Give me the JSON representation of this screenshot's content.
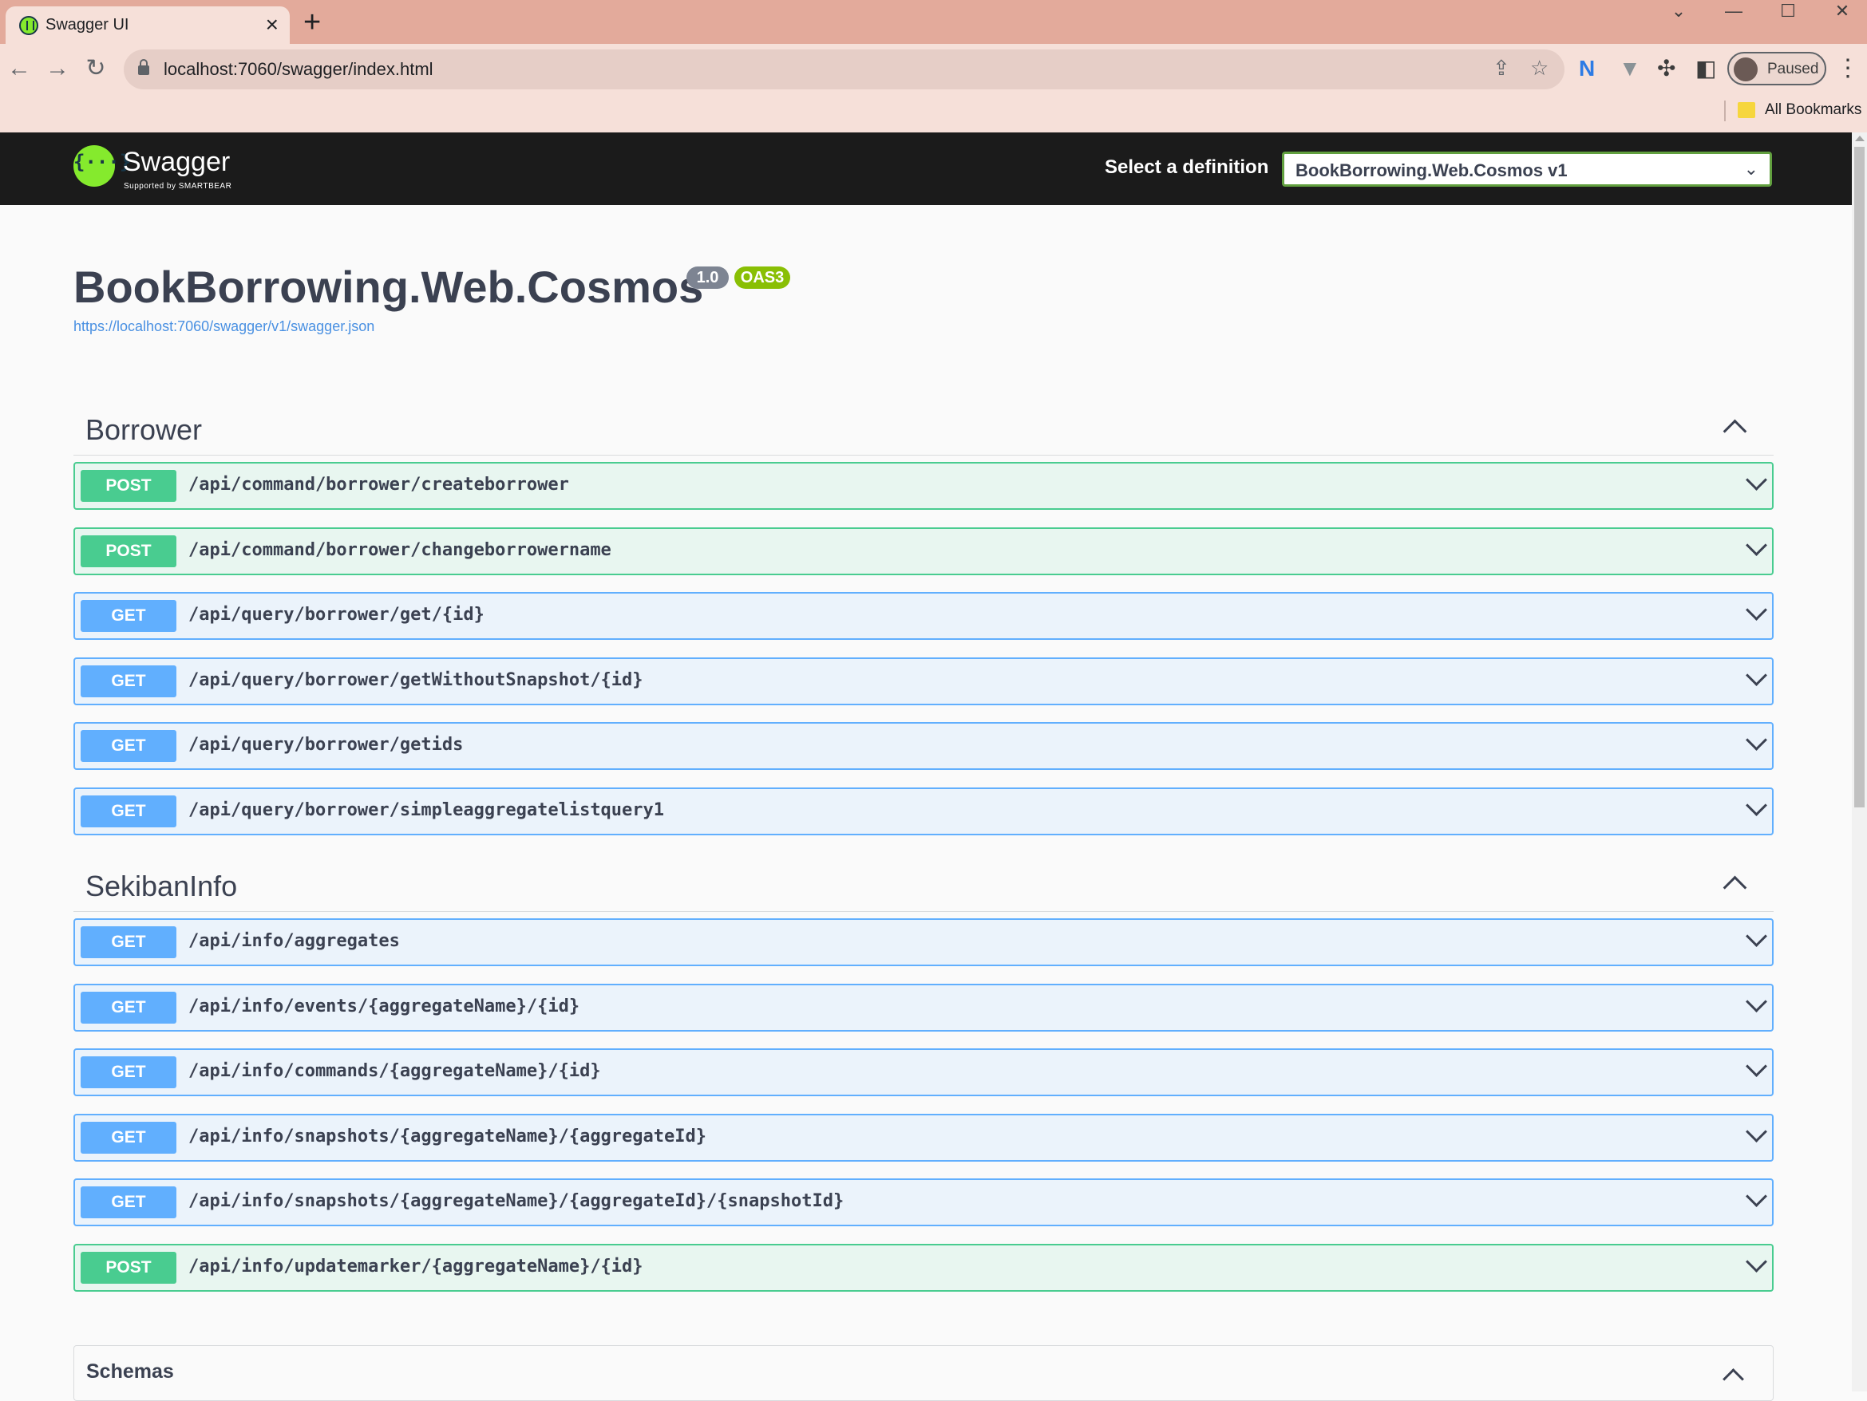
{
  "browser": {
    "tab_title": "Swagger UI",
    "url": "localhost:7060/swagger/index.html",
    "profile_status": "Paused",
    "bookmarks_label": "All Bookmarks"
  },
  "topbar": {
    "logo_text": "Swagger",
    "logo_sub": "Supported by SMARTBEAR",
    "select_label": "Select a definition",
    "definition_value": "BookBorrowing.Web.Cosmos v1"
  },
  "info": {
    "title": "BookBorrowing.Web.Cosmos",
    "version": "1.0",
    "oas": "OAS3",
    "spec_url": "https://localhost:7060/swagger/v1/swagger.json"
  },
  "tags": [
    {
      "name": "Borrower",
      "operations": [
        {
          "method": "POST",
          "path": "/api/command/borrower/createborrower"
        },
        {
          "method": "POST",
          "path": "/api/command/borrower/changeborrowername"
        },
        {
          "method": "GET",
          "path": "/api/query/borrower/get/{id}"
        },
        {
          "method": "GET",
          "path": "/api/query/borrower/getWithoutSnapshot/{id}"
        },
        {
          "method": "GET",
          "path": "/api/query/borrower/getids"
        },
        {
          "method": "GET",
          "path": "/api/query/borrower/simpleaggregatelistquery1"
        }
      ]
    },
    {
      "name": "SekibanInfo",
      "operations": [
        {
          "method": "GET",
          "path": "/api/info/aggregates"
        },
        {
          "method": "GET",
          "path": "/api/info/events/{aggregateName}/{id}"
        },
        {
          "method": "GET",
          "path": "/api/info/commands/{aggregateName}/{id}"
        },
        {
          "method": "GET",
          "path": "/api/info/snapshots/{aggregateName}/{aggregateId}"
        },
        {
          "method": "GET",
          "path": "/api/info/snapshots/{aggregateName}/{aggregateId}/{snapshotId}"
        },
        {
          "method": "POST",
          "path": "/api/info/updatemarker/{aggregateName}/{id}"
        }
      ]
    }
  ],
  "schemas": {
    "title": "Schemas"
  },
  "colors": {
    "post": "#49cc90",
    "get": "#61affe",
    "swagger_green": "#85ea2d",
    "topbar": "#1b1b1b"
  }
}
